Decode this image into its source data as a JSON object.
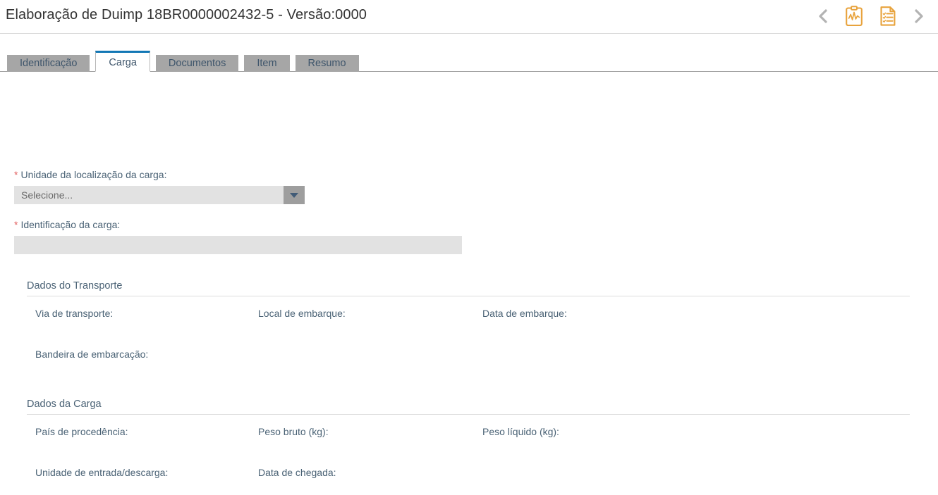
{
  "header": {
    "title": "Elaboração de Duimp 18BR0000002432-5 - Versão:0000",
    "prev_label": "‹",
    "next_label": "›",
    "icons": {
      "chart_clipboard": "clipboard-chart-icon",
      "document_list": "document-list-icon",
      "prev": "chevron-left-icon",
      "next": "chevron-right-icon"
    },
    "accent_color": "#e8a33d",
    "chevron_color": "#b3b3b3"
  },
  "tabs": [
    {
      "label": "Identificação",
      "active": false
    },
    {
      "label": "Carga",
      "active": true
    },
    {
      "label": "Documentos",
      "active": false
    },
    {
      "label": "Item",
      "active": false
    },
    {
      "label": "Resumo",
      "active": false
    }
  ],
  "form": {
    "required_marker": "*",
    "unidade_localizacao": {
      "label": "Unidade da localização da carga:",
      "selected": "Selecione...",
      "required": true
    },
    "identificacao_carga": {
      "label": "Identificação da carga:",
      "value": "",
      "placeholder": "",
      "required": true
    }
  },
  "sections": [
    {
      "title": "Dados do Transporte",
      "rows": [
        [
          {
            "label": "Via de transporte:",
            "value": ""
          },
          {
            "label": "Local de embarque:",
            "value": ""
          },
          {
            "label": "Data de embarque:",
            "value": ""
          }
        ],
        [
          {
            "label": "Bandeira de embarcação:",
            "value": ""
          }
        ]
      ]
    },
    {
      "title": "Dados da Carga",
      "rows": [
        [
          {
            "label": "País de procedência:",
            "value": ""
          },
          {
            "label": "Peso bruto (kg):",
            "value": ""
          },
          {
            "label": "Peso líquido (kg):",
            "value": ""
          }
        ],
        [
          {
            "label": "Unidade de entrada/descarga:",
            "value": ""
          },
          {
            "label": "Data de chegada:",
            "value": ""
          }
        ]
      ]
    }
  ],
  "colors": {
    "tab_active_border": "#1277b5",
    "tab_inactive_bg": "#a6a6a6",
    "label_text": "#4a6275",
    "required_star": "#e15d5d",
    "input_bg": "#e2e2e2"
  }
}
